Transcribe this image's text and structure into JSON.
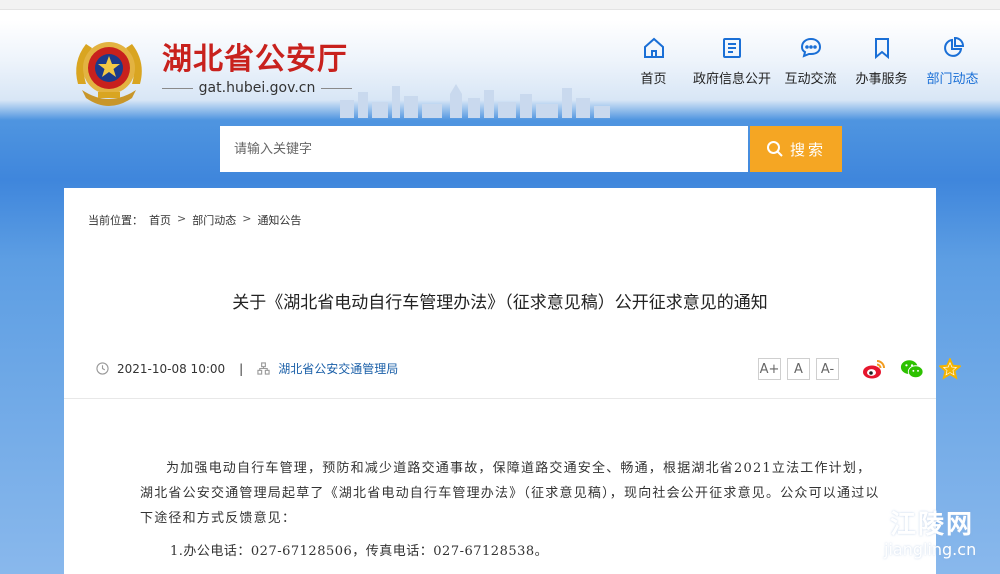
{
  "site": {
    "title": "湖北省公安厅",
    "domain": "gat.hubei.gov.cn"
  },
  "nav": [
    {
      "label": "首页",
      "icon": "home-icon"
    },
    {
      "label": "政府信息公开",
      "icon": "document-icon"
    },
    {
      "label": "互动交流",
      "icon": "chat-icon"
    },
    {
      "label": "办事服务",
      "icon": "bookmark-icon"
    },
    {
      "label": "部门动态",
      "icon": "pie-chart-icon",
      "active": true
    }
  ],
  "search": {
    "placeholder": "请输入关键字",
    "button_label": "搜索"
  },
  "breadcrumb": {
    "prefix": "当前位置：",
    "items": [
      "首页",
      "部门动态",
      "通知公告"
    ],
    "separator": ">"
  },
  "article": {
    "title": "关于《湖北省电动自行车管理办法》（征求意见稿）公开征求意见的通知",
    "datetime": "2021-10-08 10:00",
    "divider": "|",
    "source": "湖北省公安交通管理局",
    "font_sizes": [
      "A+",
      "A",
      "A-"
    ],
    "share": [
      "weibo-icon",
      "wechat-icon",
      "favorite-star-icon"
    ],
    "paragraph1": "为加强电动自行车管理，预防和减少道路交通事故，保障道路交通安全、畅通，根据湖北省2021立法工作计划，湖北省公安交通管理局起草了《湖北省电动自行车管理办法》（征求意见稿），现向社会公开征求意见。公众可以通过以下途径和方式反馈意见：",
    "item1": "1.办公电话：027-67128506，传真电话：027-67128538。"
  },
  "watermark": {
    "title": "江陵网",
    "url": "jiangling.cn"
  },
  "colors": {
    "brand_red": "#c8211d",
    "accent_blue": "#1a6fd6",
    "search_orange": "#f5a623"
  }
}
